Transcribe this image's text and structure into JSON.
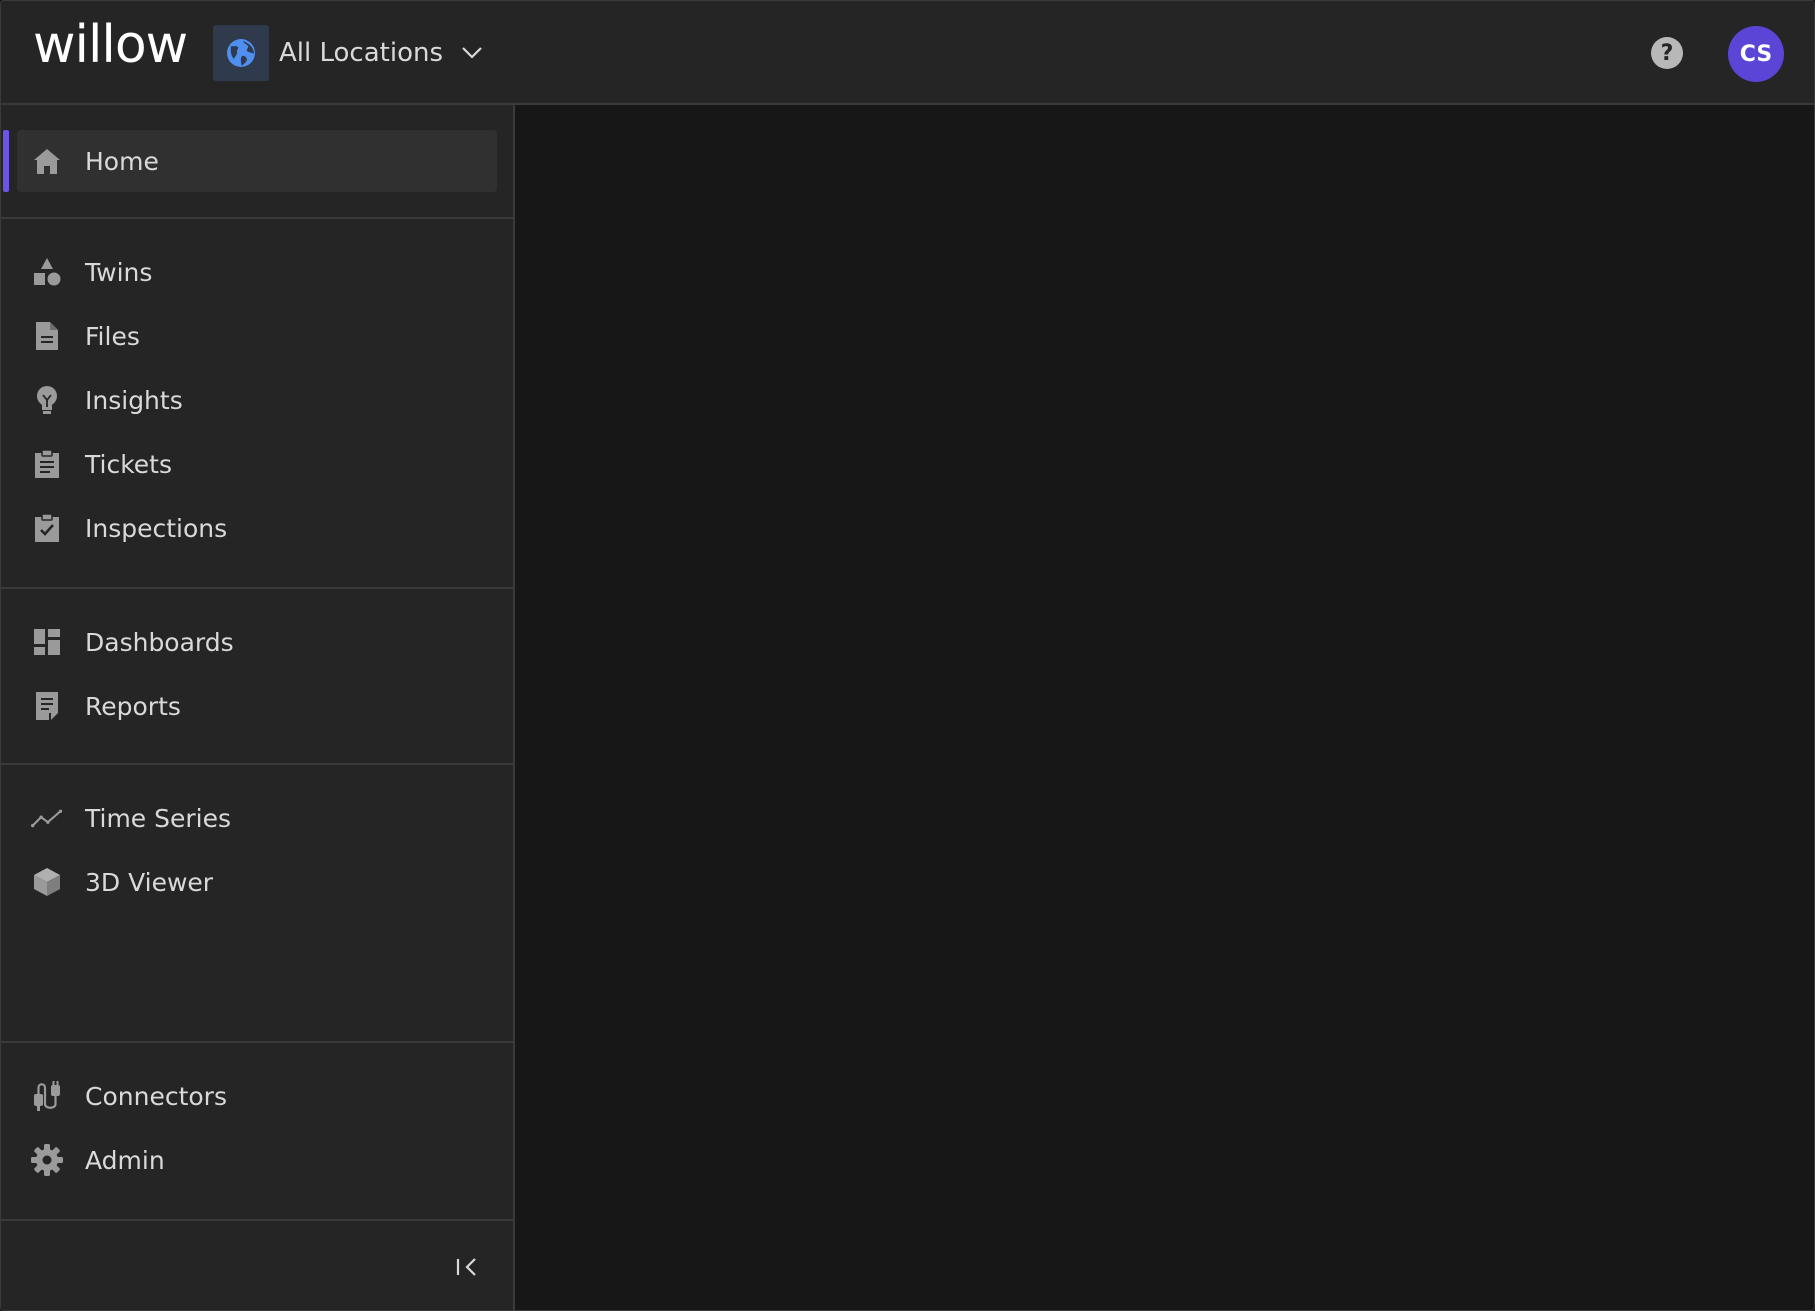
{
  "header": {
    "logo_text": "willow",
    "location_label": "All Locations",
    "help_symbol": "?",
    "avatar_initials": "CS"
  },
  "colors": {
    "accent": "#6a55e6",
    "avatar_bg": "#5a45d6",
    "globe": "#4f8ff0"
  },
  "sidebar": {
    "sections": [
      {
        "items": [
          {
            "label": "Home",
            "icon": "home-icon",
            "active": true
          }
        ]
      },
      {
        "items": [
          {
            "label": "Twins",
            "icon": "shapes-icon"
          },
          {
            "label": "Files",
            "icon": "file-icon"
          },
          {
            "label": "Insights",
            "icon": "lightbulb-icon"
          },
          {
            "label": "Tickets",
            "icon": "clipboard-icon"
          },
          {
            "label": "Inspections",
            "icon": "checklist-icon"
          }
        ]
      },
      {
        "items": [
          {
            "label": "Dashboards",
            "icon": "dashboard-icon"
          },
          {
            "label": "Reports",
            "icon": "report-icon"
          }
        ]
      },
      {
        "items": [
          {
            "label": "Time Series",
            "icon": "line-chart-icon"
          },
          {
            "label": "3D Viewer",
            "icon": "cube-icon"
          }
        ]
      },
      {
        "items": [
          {
            "label": "Connectors",
            "icon": "plug-icon"
          },
          {
            "label": "Admin",
            "icon": "gear-icon"
          }
        ]
      }
    ],
    "collapse_icon": "collapse-sidebar-icon"
  }
}
